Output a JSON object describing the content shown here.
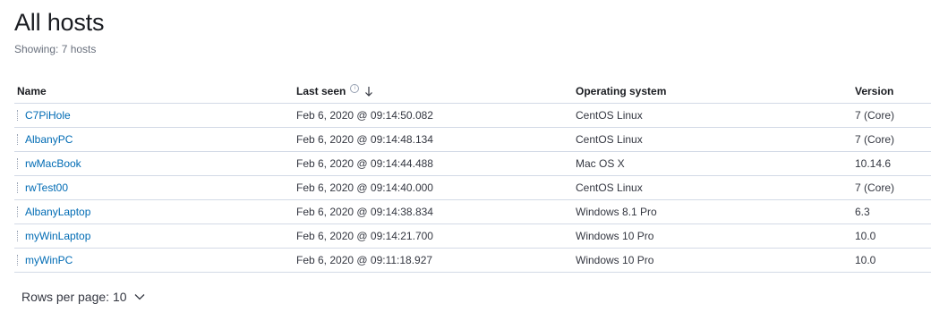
{
  "header": {
    "title": "All hosts",
    "subtitle": "Showing: 7 hosts"
  },
  "table": {
    "columns": {
      "name": "Name",
      "last_seen": "Last seen",
      "os": "Operating system",
      "version": "Version"
    },
    "sort": {
      "column": "last_seen",
      "direction": "descending",
      "icon": "arrow-down-icon"
    },
    "info_icon": "info-icon",
    "rows": [
      {
        "name": "C7PiHole",
        "last_seen": "Feb 6, 2020 @ 09:14:50.082",
        "os": "CentOS Linux",
        "version": "7 (Core)"
      },
      {
        "name": "AlbanyPC",
        "last_seen": "Feb 6, 2020 @ 09:14:48.134",
        "os": "CentOS Linux",
        "version": "7 (Core)"
      },
      {
        "name": "rwMacBook",
        "last_seen": "Feb 6, 2020 @ 09:14:44.488",
        "os": "Mac OS X",
        "version": "10.14.6"
      },
      {
        "name": "rwTest00",
        "last_seen": "Feb 6, 2020 @ 09:14:40.000",
        "os": "CentOS Linux",
        "version": "7 (Core)"
      },
      {
        "name": "AlbanyLaptop",
        "last_seen": "Feb 6, 2020 @ 09:14:38.834",
        "os": "Windows 8.1 Pro",
        "version": "6.3"
      },
      {
        "name": "myWinLaptop",
        "last_seen": "Feb 6, 2020 @ 09:14:21.700",
        "os": "Windows 10 Pro",
        "version": "10.0"
      },
      {
        "name": "myWinPC",
        "last_seen": "Feb 6, 2020 @ 09:11:18.927",
        "os": "Windows 10 Pro",
        "version": "10.0"
      }
    ]
  },
  "pagination": {
    "rows_per_page_label": "Rows per page: 10"
  },
  "colors": {
    "link": "#006bb4",
    "border": "#d3dae6",
    "text": "#343741",
    "muted": "#69707d"
  }
}
